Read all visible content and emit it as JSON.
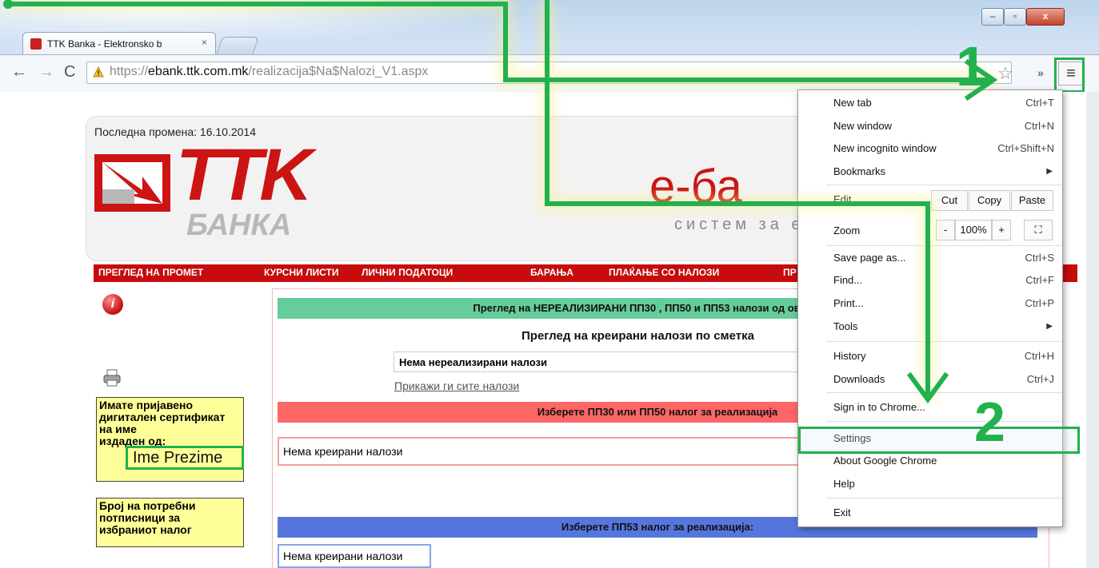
{
  "browser": {
    "tab_title": "TTK Banka - Elektronsko b",
    "tab_close": "×",
    "url_prefix": "https://",
    "url_domain": "ebank.ttk.com.mk",
    "url_path": "/realizacija$Na$Nalozi_V1.aspx",
    "window_buttons": {
      "minimize": "–",
      "maximize": "▫",
      "close": "x"
    },
    "overflow_chevron": "»"
  },
  "page": {
    "last_change": "Последна промена: 16.10.2014",
    "logo_main": "TTK",
    "logo_sub": "БАНКА",
    "logo_right": "е-ба",
    "logo_tagline": "систем за еле",
    "nav": [
      "ПРЕГЛЕД НА ПРОМЕТ",
      "КУРСНИ ЛИСТИ",
      "ЛИЧНИ ПОДАТОЦИ",
      "БАРАЊА",
      "ПЛАЌАЊЕ СО НАЛОЗИ",
      "ПР"
    ],
    "cert_text": "Имате пријавено дигитален сертификат на име",
    "cert_issued": "издаден од:",
    "cert_name": "Ime Prezime",
    "signers_text": "Број на потребни потписници за избраниот налог",
    "header_unrealized": "Преглед на НЕРЕАЛИЗИРАНИ ПП30 , ПП50 и ПП53 налози од овластени",
    "sub_title": "Преглед на креирани налози по сметка",
    "no_unrealized": "Нема нереализирани налози",
    "show_all_link": "Прикажи ги сите налози",
    "header_pp30": "Изберете ПП30 или ПП50 налог за реализација",
    "no_created_1": "Нема креирани налози",
    "header_pp53": "Изберете ПП53 налог за реализација:",
    "no_created_2": "Нема креирани налози"
  },
  "menu": {
    "new_tab": "New tab",
    "new_tab_sc": "Ctrl+T",
    "new_window": "New window",
    "new_window_sc": "Ctrl+N",
    "incognito": "New incognito window",
    "incognito_sc": "Ctrl+Shift+N",
    "bookmarks": "Bookmarks",
    "edit": "Edit",
    "cut": "Cut",
    "copy": "Copy",
    "paste": "Paste",
    "zoom": "Zoom",
    "zoom_minus": "-",
    "zoom_value": "100%",
    "zoom_plus": "+",
    "save_page": "Save page as...",
    "save_page_sc": "Ctrl+S",
    "find": "Find...",
    "find_sc": "Ctrl+F",
    "print": "Print...",
    "print_sc": "Ctrl+P",
    "tools": "Tools",
    "history": "History",
    "history_sc": "Ctrl+H",
    "downloads": "Downloads",
    "downloads_sc": "Ctrl+J",
    "sign_in": "Sign in to Chrome...",
    "settings": "Settings",
    "about": "About Google Chrome",
    "help": "Help",
    "exit": "Exit"
  },
  "annotations": {
    "step1": "1",
    "step2": "2",
    "color": "#22b14c"
  }
}
